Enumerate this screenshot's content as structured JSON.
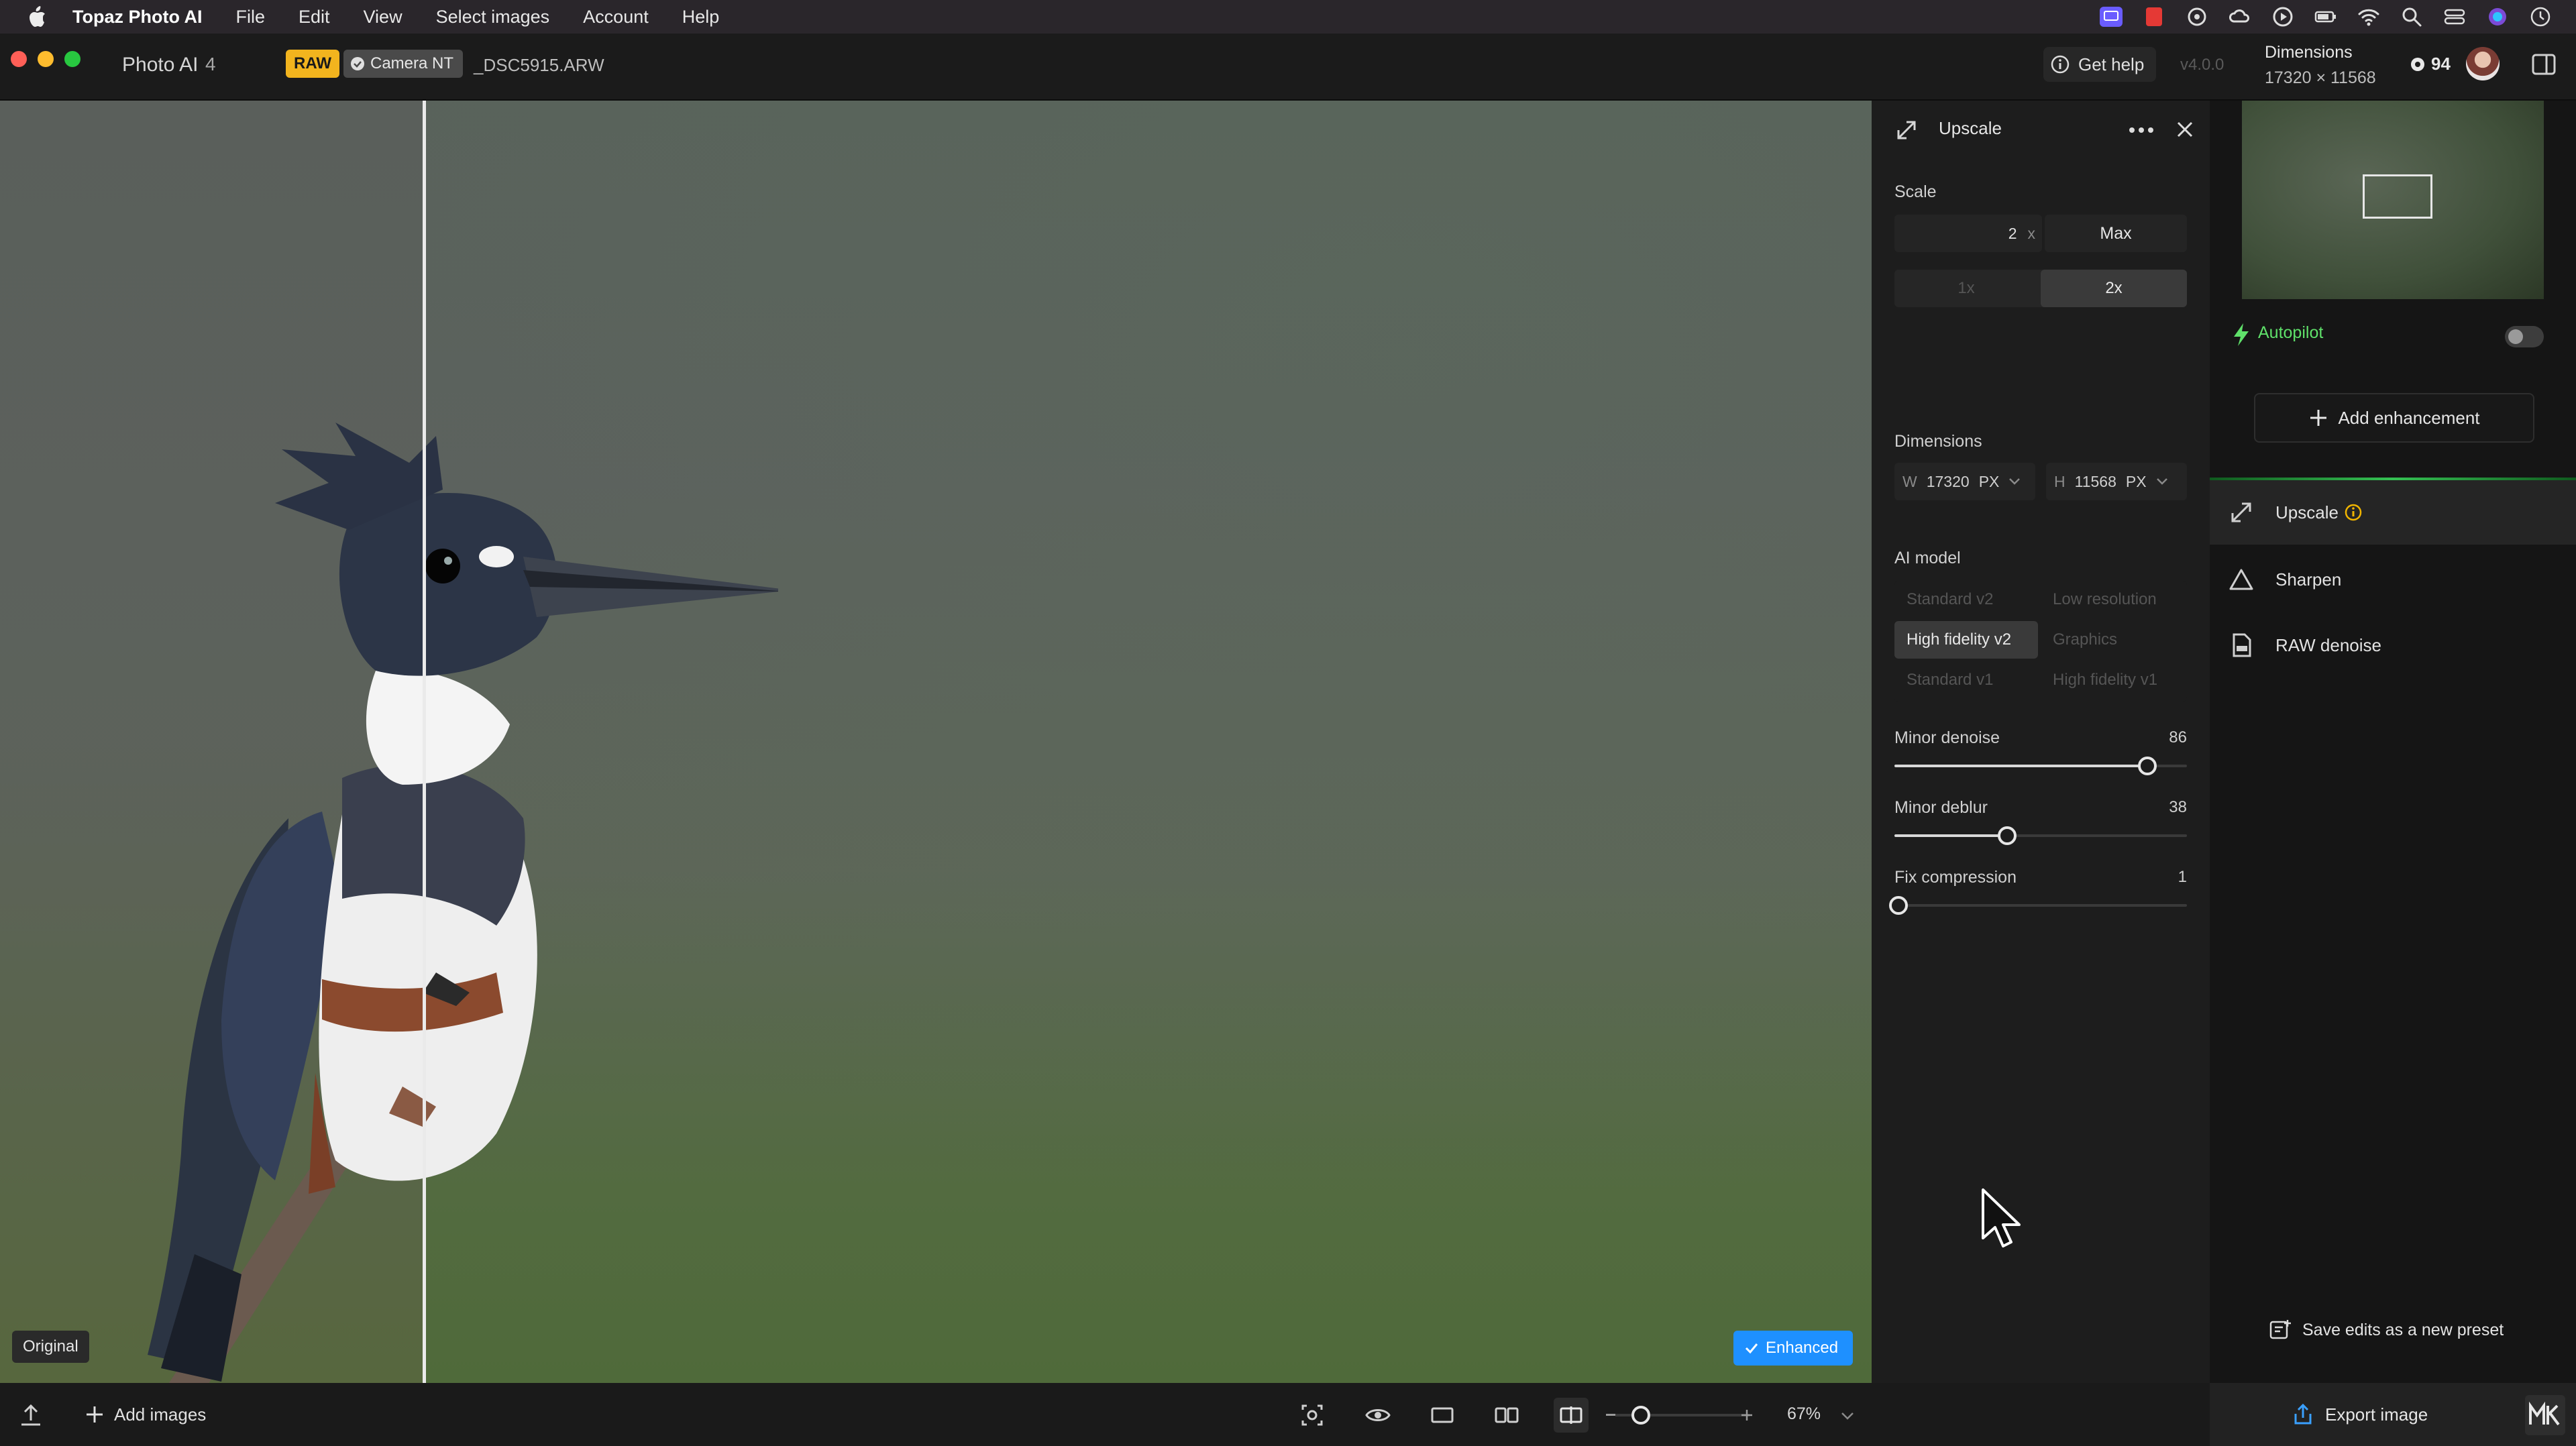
{
  "menubar": {
    "app_name": "Topaz Photo AI",
    "items": [
      "File",
      "Edit",
      "View",
      "Select images",
      "Account",
      "Help"
    ]
  },
  "titlebar": {
    "app_name": "Photo AI",
    "image_count": "4",
    "raw_badge": "RAW",
    "camera_badge": "Camera NT",
    "file_name": "_DSC5915.ARW",
    "get_help": "Get help",
    "version": "v4.0.0",
    "dimensions_label": "Dimensions",
    "dimensions_value": "17320 × 11568",
    "credits": "94"
  },
  "canvas": {
    "original_label": "Original",
    "enhanced_label": "Enhanced"
  },
  "settings": {
    "title": "Upscale",
    "scale_label": "Scale",
    "scale_value": "2",
    "scale_unit": "x",
    "max_label": "Max",
    "scale_presets": [
      "1x",
      "2x"
    ],
    "scale_selected": "2x",
    "dimensions_label": "Dimensions",
    "width_prefix": "W",
    "width_value": "17320",
    "width_unit": "PX",
    "height_prefix": "H",
    "height_value": "11568",
    "height_unit": "PX",
    "ai_model_label": "AI model",
    "models": [
      "Standard v2",
      "Low resolution",
      "High fidelity v2",
      "Graphics",
      "Standard v1",
      "High fidelity v1"
    ],
    "model_selected": "High fidelity v2",
    "sliders": [
      {
        "label": "Minor denoise",
        "value": 86,
        "display": "86"
      },
      {
        "label": "Minor deblur",
        "value": 38,
        "display": "38"
      },
      {
        "label": "Fix compression",
        "value": 1,
        "display": "1"
      }
    ]
  },
  "rightpanel": {
    "autopilot_label": "Autopilot",
    "autopilot_on": false,
    "add_enhancement": "Add enhancement",
    "enhancements": [
      {
        "label": "Upscale",
        "icon": "expand-arrows-icon"
      },
      {
        "label": "Sharpen",
        "icon": "triangle-icon"
      },
      {
        "label": "RAW denoise",
        "icon": "raw-file-icon"
      }
    ],
    "save_preset": "Save edits as a new preset",
    "export": "Export image"
  },
  "bottombar": {
    "add_images": "Add images",
    "zoom": "67%"
  },
  "colors": {
    "accent_blue": "#1e90ff",
    "raw_yellow": "#f2b41e",
    "autopilot_green": "#5fe06a"
  }
}
